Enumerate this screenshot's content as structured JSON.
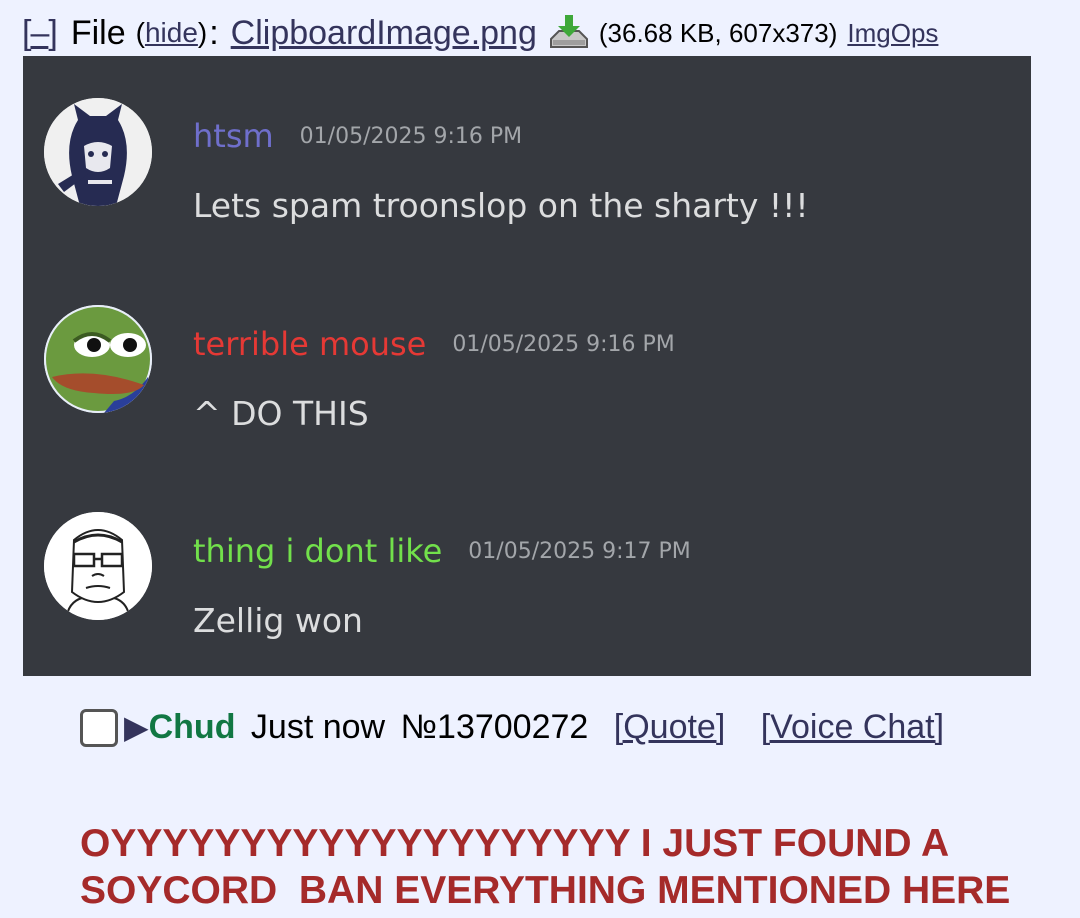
{
  "file_info": {
    "toggle_open": "[",
    "toggle_label": "–",
    "toggle_close": "]",
    "label": "File",
    "hide_open": "(",
    "hide_label": "hide",
    "hide_close": ")",
    "colon": ":",
    "filename": "ClipboardImage.png",
    "download_icon": "download-icon",
    "meta": "(36.68 KB, 607x373)",
    "imgops_label": "ImgOps"
  },
  "discord_image": {
    "background": "#36393f",
    "messages": [
      {
        "username": "htsm",
        "username_color": "#6f6fcc",
        "timestamp": "01/05/2025 9:16 PM",
        "text": "Lets spam troonslop on the sharty !!!",
        "avatar": "dark-character-avatar"
      },
      {
        "username": "terrible mouse",
        "username_color": "#e53935",
        "timestamp": "01/05/2025 9:16 PM",
        "text": "^ DO THIS",
        "avatar": "frog-avatar"
      },
      {
        "username": "thing i dont like",
        "username_color": "#72e04b",
        "timestamp": "01/05/2025 9:17 PM",
        "text": "Zellig won",
        "avatar": "glasses-man-avatar"
      }
    ]
  },
  "post": {
    "arrow": "▶",
    "name": "Chud",
    "date": "Just now",
    "number": "№13700272",
    "quote_label": "[Quote]",
    "voice_label": "[Voice Chat]",
    "message": "OYYYYYYYYYYYYYYYYYYYY I JUST FOUND A\nSOYCORD  BAN EVERYTHING MENTIONED HERE",
    "name_color": "#117743",
    "message_color": "#a52a2a",
    "link_color": "#34345c"
  }
}
